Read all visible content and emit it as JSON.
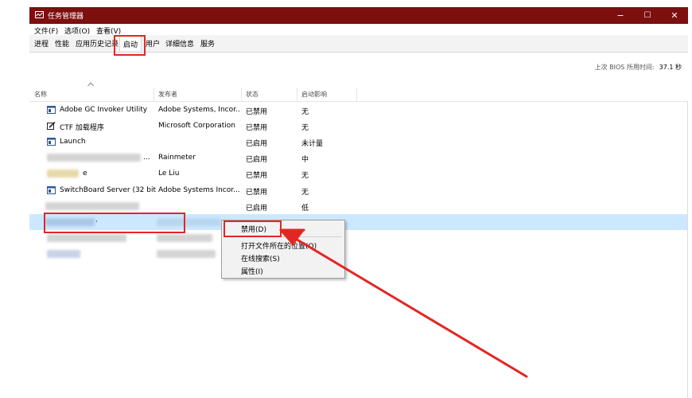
{
  "window": {
    "title": "任务管理器",
    "minimize_symbol": "−",
    "maximize_symbol": "☐",
    "close_symbol": "✕"
  },
  "menu": [
    "文件(F)",
    "选项(O)",
    "查看(V)"
  ],
  "tabs": [
    {
      "label": "进程",
      "active": false
    },
    {
      "label": "性能",
      "active": false
    },
    {
      "label": "应用历史记录",
      "active": false
    },
    {
      "label": "启动",
      "active": true
    },
    {
      "label": "用户",
      "active": false
    },
    {
      "label": "详细信息",
      "active": false
    },
    {
      "label": "服务",
      "active": false
    }
  ],
  "bios": {
    "label": "上次 BIOS 所用时间:",
    "value": "37.1 秒"
  },
  "columns": {
    "name": "名称",
    "publisher": "发布者",
    "status": "状态",
    "impact": "启动影响"
  },
  "rows": [
    {
      "name": "Adobe GC Invoker Utility",
      "publisher": "Adobe Systems, Incor...",
      "status": "已禁用",
      "impact": "无",
      "icon": "app-window-icon"
    },
    {
      "name": "CTF 加载程序",
      "publisher": "Microsoft Corporation",
      "status": "已禁用",
      "impact": "无",
      "icon": "pen-icon"
    },
    {
      "name": "Launch",
      "publisher": "",
      "status": "已启用",
      "impact": "未计量",
      "icon": "app-window-icon"
    },
    {
      "name": "...",
      "publisher": "Rainmeter",
      "status": "已启用",
      "impact": "中",
      "icon": "blurred-icon"
    },
    {
      "name": "e",
      "publisher": "Le Liu",
      "status": "已禁用",
      "impact": "无",
      "icon": "blurred-icon"
    },
    {
      "name": "SwitchBoard Server (32 bit)",
      "publisher": "Adobe Systems Incor...",
      "status": "已禁用",
      "impact": "无",
      "icon": "app-window-icon"
    },
    {
      "name": "",
      "publisher": "",
      "status": "已启用",
      "impact": "低",
      "icon": "blurred-icon"
    },
    {
      "name": "·",
      "publisher": "",
      "status": "",
      "impact": "",
      "icon": "blurred-icon",
      "selected": true
    }
  ],
  "context_menu": {
    "disable": "禁用(D)",
    "open_location": "打开文件所在的位置(O)",
    "search_online": "在线搜索(S)",
    "properties": "属性(I)"
  },
  "colors": {
    "titlebar": "#7d0f0f",
    "selection": "#cce8ff",
    "annotation": "#e32623"
  }
}
